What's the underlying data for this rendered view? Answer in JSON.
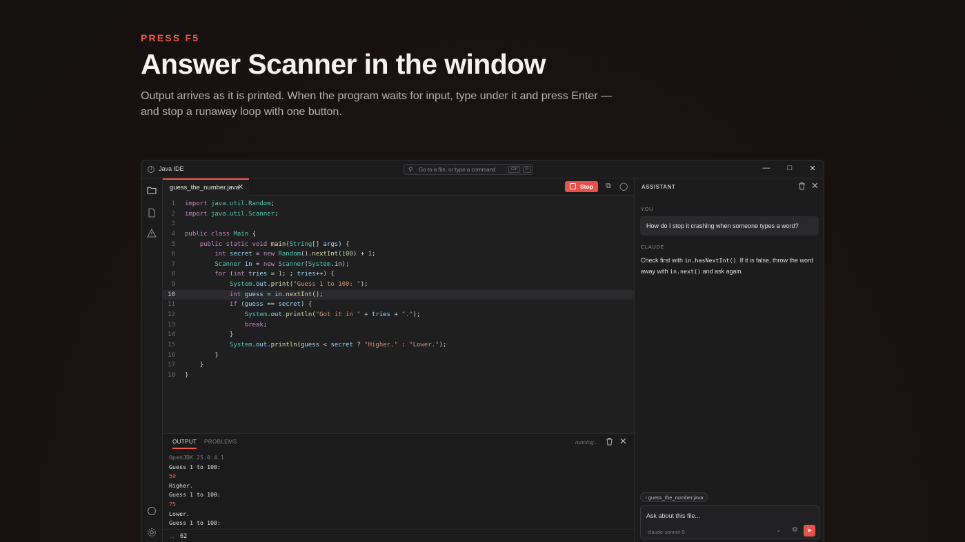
{
  "hero": {
    "eyebrow": "PRESS F5",
    "headline": "Answer Scanner in the window",
    "subtitle": "Output arrives as it is printed. When the program waits for input, type under it and press Enter — and stop a runaway loop with one button."
  },
  "window": {
    "title": "Java IDE",
    "command_placeholder": "Go to a file, or type a command",
    "shortcut_ctrl": "Ctrl",
    "shortcut_key": "P"
  },
  "editor": {
    "tab_label": "guess_the_number.java",
    "stop_label": "Stop",
    "active_line": 10,
    "line_numbers": [
      "1",
      "2",
      "3",
      "4",
      "5",
      "6",
      "7",
      "8",
      "9",
      "10",
      "11",
      "12",
      "13",
      "14",
      "15",
      "16",
      "17",
      "18"
    ]
  },
  "panel": {
    "tab_output": "OUTPUT",
    "tab_problems": "PROBLEMS",
    "status": "running...",
    "lines": [
      {
        "text": "OpenJDK 25.0.4.1",
        "kind": "dim"
      },
      {
        "text": "Guess 1 to 100:",
        "kind": "out"
      },
      {
        "text": "50",
        "kind": "in"
      },
      {
        "text": "Higher.",
        "kind": "out"
      },
      {
        "text": "Guess 1 to 100:",
        "kind": "out"
      },
      {
        "text": "75",
        "kind": "in"
      },
      {
        "text": "Lower.",
        "kind": "out"
      },
      {
        "text": "Guess 1 to 100:",
        "kind": "out"
      }
    ],
    "input_value": "62"
  },
  "assistant": {
    "header": "ASSISTANT",
    "you_label": "YOU",
    "question": "How do I stop it crashing when someone types a word?",
    "claude_label": "CLAUDE",
    "answer_1": "Check first with ",
    "answer_code_1": "in.hasNextInt()",
    "answer_2": ". If it is false, throw the word away with ",
    "answer_code_2": "in.next()",
    "answer_3": " and ask again.",
    "file_chip": "guess_the_number.java",
    "composer_placeholder": "Ask about this file...",
    "model": "claude-sonnet-5"
  },
  "colors": {
    "accent": "#ef5a48",
    "background": "#141010",
    "editor_bg": "#1f1f20"
  }
}
